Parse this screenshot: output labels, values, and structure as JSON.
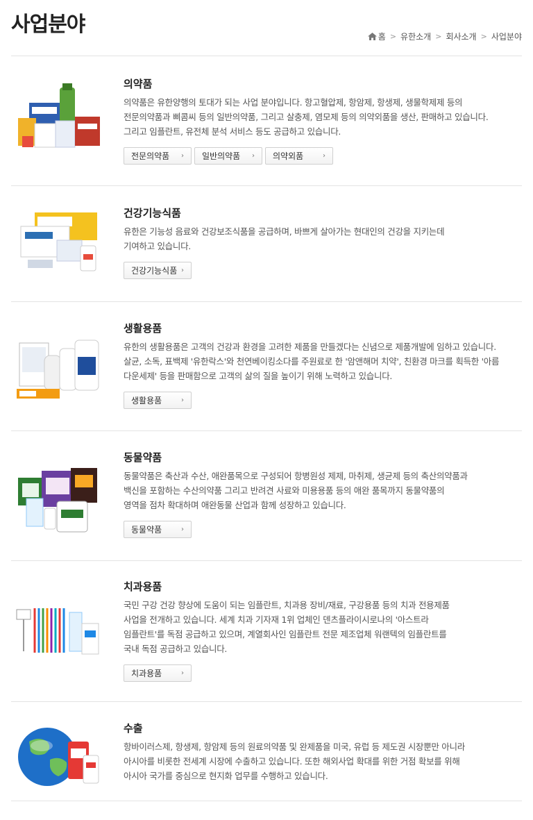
{
  "page": {
    "title": "사업분야"
  },
  "breadcrumb": {
    "items": [
      "홈",
      "유한소개",
      "회사소개",
      "사업분야"
    ]
  },
  "sections": [
    {
      "title": "의약품",
      "lines": [
        "의약품은 유한양행의 토대가 되는 사업 분야입니다. 항고혈압제, 항암제, 항생제, 생물학제제 등의",
        "전문의약품과 삐콤씨 등의 일반의약품, 그리고 살충제, 염모제 등의 의약외품을 생산, 판매하고 있습니다.",
        "그리고 임플란트, 유전체 분석 서비스 등도 공급하고 있습니다."
      ],
      "buttons": [
        "전문의약품",
        "일반의약품",
        "의약외품"
      ]
    },
    {
      "title": "건강기능식품",
      "lines": [
        "유한은 기능성 음료와 건강보조식품을 공급하며, 바쁘게 살아가는 현대인의 건강을 지키는데",
        "기여하고 있습니다."
      ],
      "buttons": [
        "건강기능식품"
      ]
    },
    {
      "title": "생활용품",
      "lines": [
        "유한의 생활용품은 고객의 건강과 환경을 고려한 제품을 만들겠다는 신념으로 제품개발에 임하고 있습니다.",
        "살균, 소독, 표백제 '유한락스'와 천연베이킹소다를 주원료로 한 '암앤해머 치약', 친환경 마크를 획득한 '아름",
        "다운세제' 등을 판매함으로 고객의 삶의 질을 높이기 위해 노력하고 있습니다."
      ],
      "buttons": [
        "생활용품"
      ]
    },
    {
      "title": "동물약품",
      "lines": [
        "동물약품은 축산과 수산, 애완품목으로 구성되어 항병원성 제제, 마취제, 생균제 등의 축산의약품과",
        "백신을 포함하는 수산의약품 그리고 반려견 사료와 미용용품 등의 애완 품목까지 동물약품의",
        "영역을 점차 확대하며 애완동물 산업과 함께 성장하고 있습니다."
      ],
      "buttons": [
        "동물약품"
      ]
    },
    {
      "title": "치과용품",
      "lines": [
        "국민 구강 건강 향상에 도움이 되는 임플란트, 치과용 장비/재료, 구강용품 등의 치과 전용제품",
        "사업을 전개하고 있습니다. 세계 치과 기자재 1위 업체인 덴츠플라이시로나의 '아스트라",
        "임플란트'를 독점 공급하고 있으며, 계열회사인 임플란트 전문 제조업체 워랜텍의 임플란트를",
        "국내 독점 공급하고 있습니다."
      ],
      "buttons": [
        "치과용품"
      ]
    },
    {
      "title": "수출",
      "lines": [
        "항바이러스제, 항생제, 항암제 등의 원료의약품 및 완제품을 미국, 유럽 등 제도권 시장뿐만 아니라",
        "아시아를 비롯한 전세계 시장에 수출하고 있습니다. 또한 해외사업 확대를 위한 거점 확보를 위해",
        "아시아 국가를 중심으로 현지화 업무를 수행하고 있습니다."
      ],
      "buttons": []
    }
  ],
  "icons": {
    "home": "home-icon",
    "chevron": "chevron-right-icon"
  },
  "colors": {
    "text": "#333333",
    "rule": "#e3e3e3",
    "button_border": "#cfcfcf"
  }
}
